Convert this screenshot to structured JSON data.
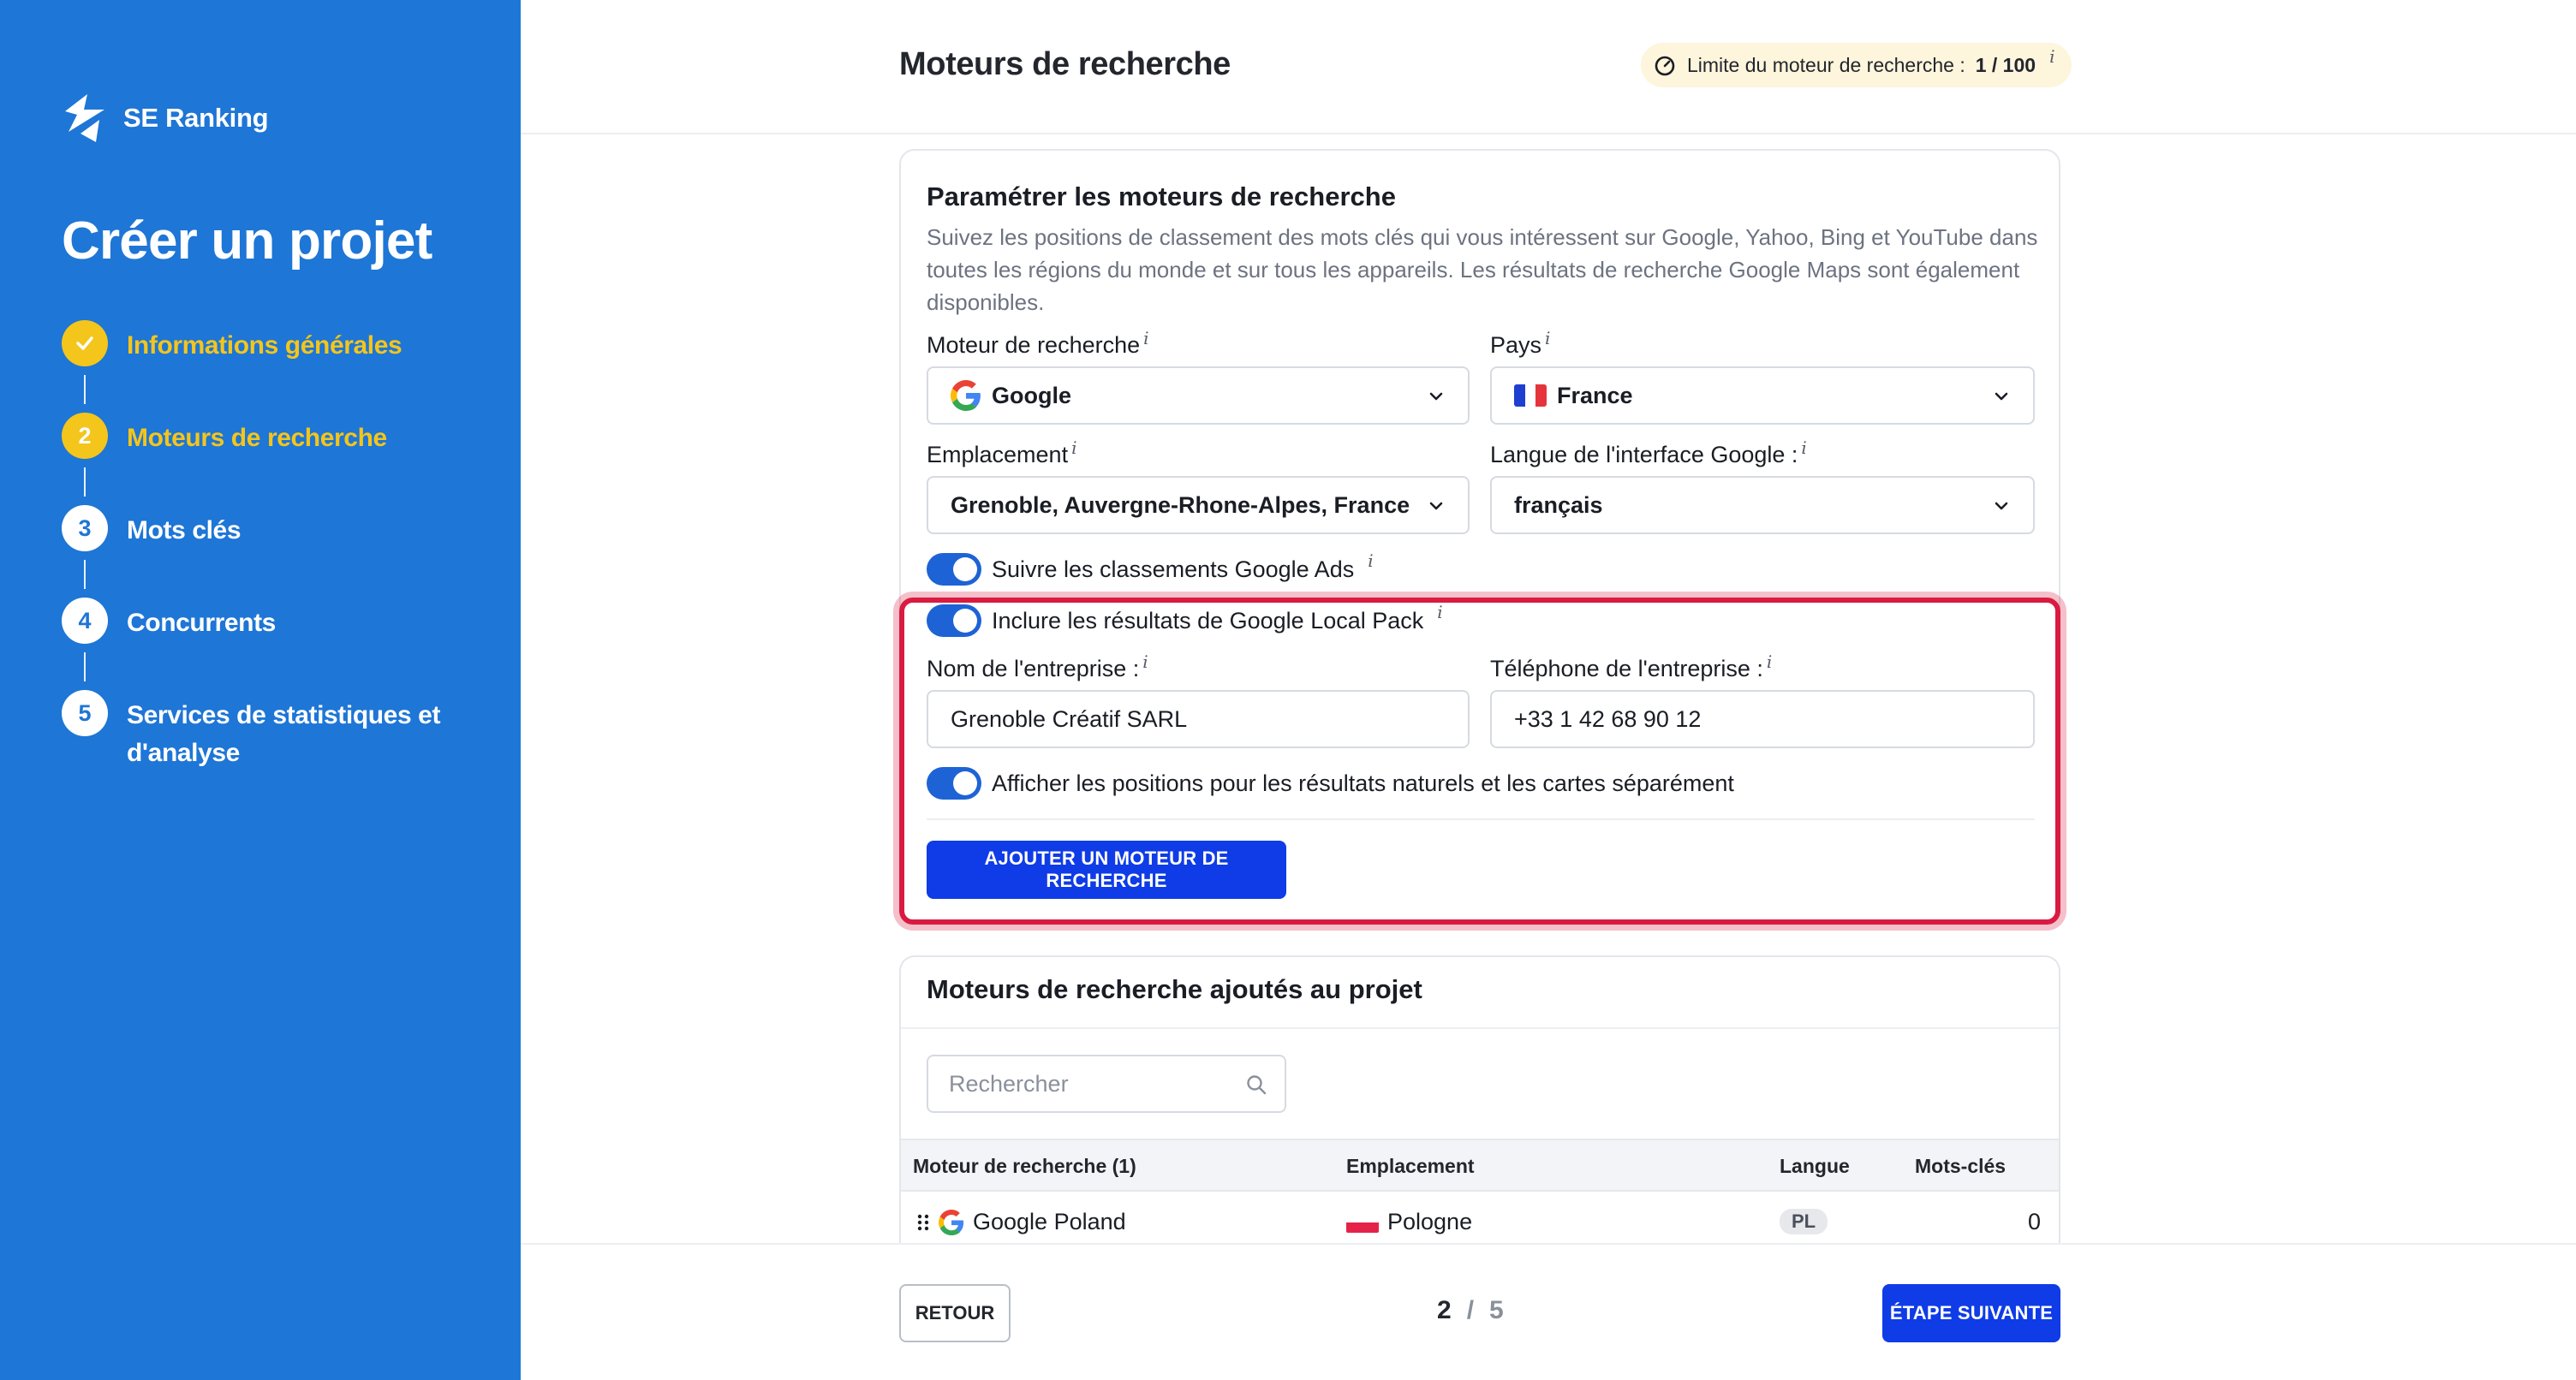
{
  "brand": {
    "name": "SE Ranking",
    "accent": "#1e76d6",
    "highlight": "#f4c51b"
  },
  "sidebar": {
    "title": "Créer un projet",
    "steps": [
      {
        "number": "",
        "label": "Informations générales",
        "state": "done"
      },
      {
        "number": "2",
        "label": "Moteurs de recherche",
        "state": "active"
      },
      {
        "number": "3",
        "label": "Mots clés",
        "state": "todo"
      },
      {
        "number": "4",
        "label": "Concurrents",
        "state": "todo"
      },
      {
        "number": "5",
        "label_line1": "Services de statistiques et",
        "label_line2": "d'analyse",
        "state": "todo"
      }
    ]
  },
  "header": {
    "title": "Moteurs de recherche",
    "limit_label": "Limite du moteur de recherche :",
    "limit_value": "1 / 100",
    "info_glyph": "i"
  },
  "settings": {
    "title": "Paramétrer les moteurs de recherche",
    "description": "Suivez les positions de classement des mots clés qui vous intéressent sur Google, Yahoo, Bing et YouTube dans toutes les régions du monde et sur tous les appareils. Les résultats de recherche Google Maps sont également disponibles.",
    "engine": {
      "label": "Moteur de recherche",
      "value": "Google",
      "icon": "google-icon"
    },
    "country": {
      "label": "Pays",
      "value": "France",
      "icon": "france-flag-icon"
    },
    "location": {
      "label": "Emplacement",
      "value": "Grenoble, Auvergne-Rhone-Alpes, France"
    },
    "interface_lang": {
      "label": "Langue de l'interface Google :",
      "value": "français"
    },
    "toggle_ads": {
      "label": "Suivre les classements Google Ads",
      "on": true
    },
    "toggle_local": {
      "label": "Inclure les résultats de Google Local Pack",
      "on": true
    },
    "company_name": {
      "label": "Nom de l'entreprise :",
      "value": "Grenoble Créatif SARL"
    },
    "company_phone": {
      "label": "Téléphone de l'entreprise :",
      "value": "+33 1 42 68 90 12"
    },
    "toggle_separate": {
      "label": "Afficher les positions pour les résultats naturels et les cartes séparément",
      "on": true
    },
    "add_button": "AJOUTER UN MOTEUR DE RECHERCHE"
  },
  "added": {
    "title": "Moteurs de recherche ajoutés au projet",
    "search_placeholder": "Rechercher",
    "columns": {
      "engine": "Moteur de recherche (1)",
      "location": "Emplacement",
      "language": "Langue",
      "keywords": "Mots-clés"
    },
    "rows": [
      {
        "engine": "Google Poland",
        "location": "Pologne",
        "language": "PL",
        "keywords": "0"
      }
    ]
  },
  "footer": {
    "back": "RETOUR",
    "page_current": "2",
    "page_sep": "/",
    "page_total": "5",
    "next": "ÉTAPE SUIVANTE"
  }
}
